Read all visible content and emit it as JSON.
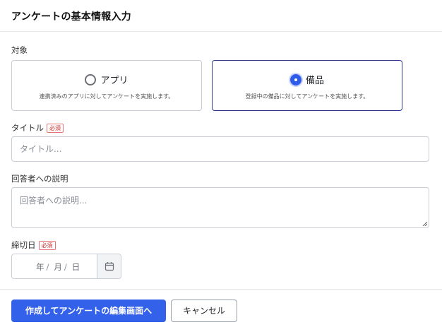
{
  "header": {
    "title": "アンケートの基本情報入力"
  },
  "target": {
    "label": "対象",
    "options": [
      {
        "title": "アプリ",
        "description": "連携済みのアプリに対してアンケートを実施します。",
        "selected": false
      },
      {
        "title": "備品",
        "description": "登録中の備品に対してアンケートを実施します。",
        "selected": true
      }
    ]
  },
  "title_field": {
    "label": "タイトル",
    "required_badge": "必須",
    "placeholder": "タイトル..."
  },
  "description_field": {
    "label": "回答者への説明",
    "placeholder": "回答者への説明..."
  },
  "deadline_field": {
    "label": "締切日",
    "required_badge": "必須",
    "year": "年",
    "month": "月",
    "day": "日",
    "separator": "/",
    "calendar_icon": "calendar-icon"
  },
  "footer": {
    "primary_label": "作成してアンケートの編集画面へ",
    "cancel_label": "キャンセル"
  },
  "colors": {
    "primary": "#3461ea",
    "selected_border": "#2b3a8f",
    "required": "#d32f2f"
  }
}
